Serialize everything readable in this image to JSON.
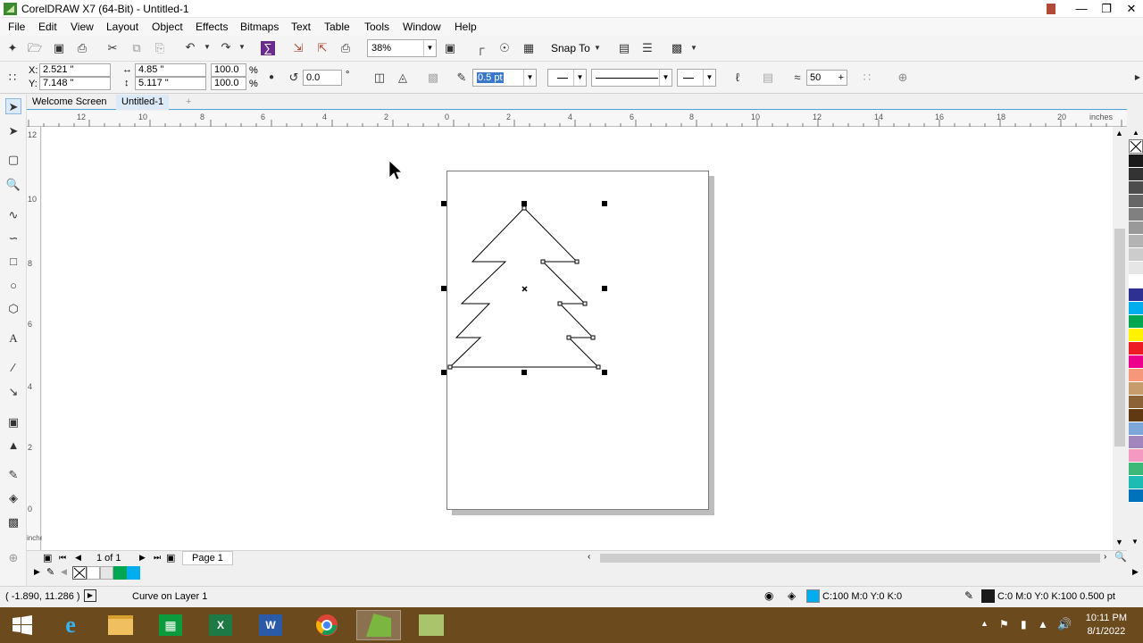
{
  "window": {
    "title": "CorelDRAW X7 (64-Bit) - Untitled-1"
  },
  "menu": [
    "File",
    "Edit",
    "View",
    "Layout",
    "Object",
    "Effects",
    "Bitmaps",
    "Text",
    "Table",
    "Tools",
    "Window",
    "Help"
  ],
  "standard_bar": {
    "zoom": "38%",
    "snap_to": "Snap To"
  },
  "property_bar": {
    "x_label": "X:",
    "x": "2.521 \"",
    "y_label": "Y:",
    "y": "7.148 \"",
    "width": "4.85 \"",
    "height": "5.117 \"",
    "scale_w": "100.0",
    "scale_h": "100.0",
    "percent": "%",
    "rotation": "0.0",
    "degree": "°",
    "outline_width": "0.5 pt",
    "smoothing": "50"
  },
  "doc_tabs": [
    "Welcome Screen",
    "Untitled-1"
  ],
  "ruler": {
    "h_labels": [
      "12",
      "10",
      "8",
      "6",
      "4",
      "2",
      "0",
      "2",
      "4",
      "6",
      "8",
      "10",
      "12",
      "14",
      "16",
      "18",
      "20"
    ],
    "unit": "inches",
    "v_labels": [
      "12",
      "10",
      "8",
      "6",
      "4",
      "2",
      "0"
    ]
  },
  "page_nav": {
    "count": "1 of 1",
    "page_tab": "Page 1"
  },
  "status": {
    "coords": "( -1.890, 11.286 )",
    "object_info": "Curve on Layer 1",
    "fill": "C:100 M:0 Y:0 K:0",
    "outline": "C:0 M:0 Y:0 K:100  0.500 pt"
  },
  "palette_colors": [
    "#1a1a1a",
    "#333333",
    "#4d4d4d",
    "#666666",
    "#808080",
    "#999999",
    "#b3b3b3",
    "#cccccc",
    "#e6e6e6",
    "#ffffff",
    "#2e3192",
    "#00aeef",
    "#00a651",
    "#fff200",
    "#ed1c24",
    "#ec008c",
    "#f7977a",
    "#c69c6d",
    "#8c6239",
    "#603913",
    "#7da7d9",
    "#a186be",
    "#f49ac2",
    "#3cb878",
    "#1cbbb4",
    "#0072bc"
  ],
  "taskbar": {
    "time": "10:11 PM",
    "date": "8/1/2022"
  }
}
